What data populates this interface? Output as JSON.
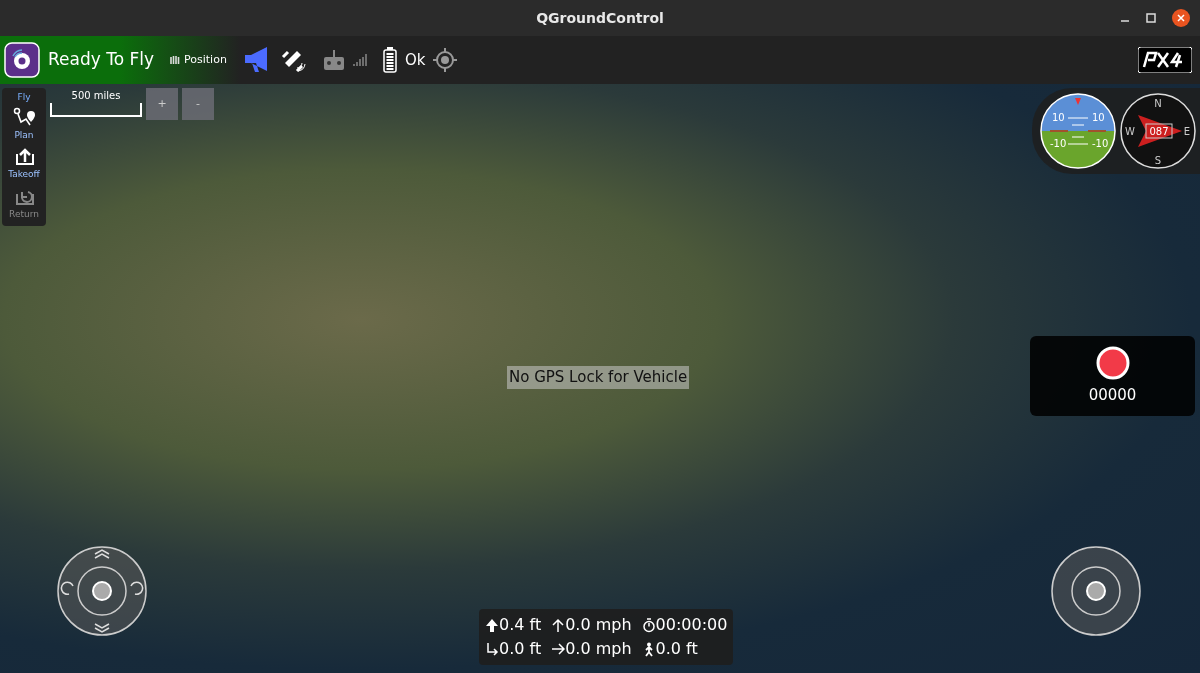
{
  "window": {
    "title": "QGroundControl"
  },
  "toolbar": {
    "status": "Ready To Fly",
    "flight_mode": "Position",
    "battery": "Ok"
  },
  "tool_header": "Fly",
  "tools": [
    {
      "kind": "plan",
      "label": "Plan",
      "disabled": false
    },
    {
      "kind": "takeoff",
      "label": "Takeoff",
      "disabled": false
    },
    {
      "kind": "return",
      "label": "Return",
      "disabled": true
    }
  ],
  "map": {
    "scale": "500 miles",
    "zoom_buttons": [
      "+",
      "-"
    ],
    "message": "No GPS Lock for Vehicle"
  },
  "attitude": {
    "pitch_labels": [
      "10",
      "10",
      "-10",
      "-10"
    ]
  },
  "compass": {
    "north": "N",
    "east": "E",
    "south": "S",
    "west": "W",
    "heading": "087"
  },
  "recorder": {
    "counter": "00000"
  },
  "telemetry": [
    {
      "kind": "altitude",
      "value": "0.4 ft"
    },
    {
      "kind": "climb",
      "value": "0.0 mph"
    },
    {
      "kind": "time",
      "value": "00:00:00"
    },
    {
      "kind": "distance",
      "value": "0.0 ft"
    },
    {
      "kind": "speed",
      "value": "0.0 mph"
    },
    {
      "kind": "home",
      "value": "0.0 ft"
    }
  ]
}
